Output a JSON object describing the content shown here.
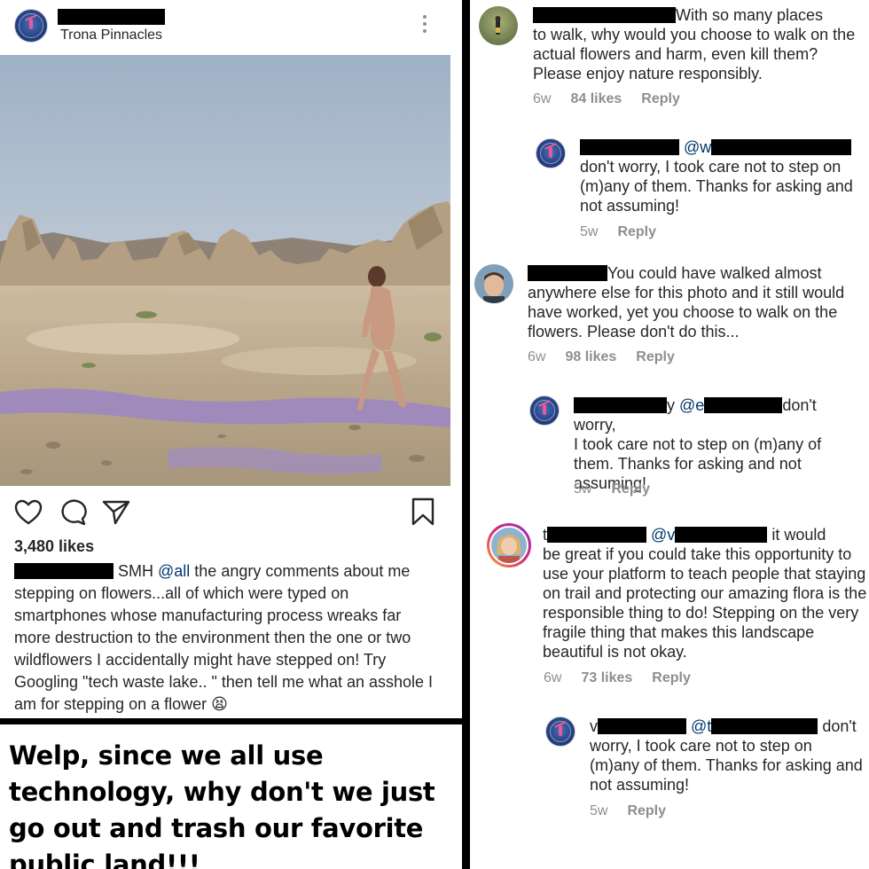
{
  "post": {
    "location": "Trona Pinnacles",
    "likes": "3,480 likes",
    "caption": {
      "text_before_mention": " SMH ",
      "mention": "@all",
      "text_after_mention": " the angry comments about me stepping on flowers...all of which were typed on smartphones whose manufacturing process wreaks far more destruction to the environment then the one or two wildflowers I accidentally might have stepped on! Try Googling \"tech waste lake.. \" then tell me what an asshole I am for stepping on a flower",
      "emoji": "😫"
    }
  },
  "meme": {
    "text": "Welp, since we all use technology, why don't we just go out and trash our favorite public land!!!"
  },
  "comments": [
    {
      "text_tail_1": "With so many places",
      "text_rest": "to walk, why would you choose to walk on the actual flowers and harm, even kill them? Please enjoy nature responsibly.",
      "age": "6w",
      "likes": "84 likes",
      "reply": "Reply"
    },
    {
      "mention": "@w",
      "text_rest": "don't worry, I took care not to step on (m)any of them. Thanks for asking and not assuming!",
      "age": "5w",
      "reply": "Reply"
    },
    {
      "text_tail_1": "You could have walked almost",
      "text_rest": "anywhere else for this photo and it still would have worked, yet you choose to walk on the flowers. Please don't do this...",
      "age": "6w",
      "likes": "98 likes",
      "reply": "Reply"
    },
    {
      "fragment": "y",
      "mention": "@e",
      "text_tail_1": "don't worry,",
      "text_rest": "I took care not to step on (m)any of them. Thanks for asking and not assuming!",
      "age": "5w",
      "reply": "Reply"
    },
    {
      "fragment": "t",
      "mention": "@v",
      "text_tail_1": "it would",
      "text_rest": "be great if you could take this opportunity to use your platform to teach people that staying on trail and protecting our amazing flora is the responsible thing to do! Stepping on the very fragile thing that makes this landscape beautiful is not okay.",
      "age": "6w",
      "likes": "73 likes",
      "reply": "Reply"
    },
    {
      "fragment": "v",
      "mention": "@t",
      "text_tail_1": "don't",
      "text_rest": "worry, I took care not to step on (m)any of them. Thanks for asking and not assuming!",
      "age": "5w",
      "reply": "Reply"
    }
  ]
}
